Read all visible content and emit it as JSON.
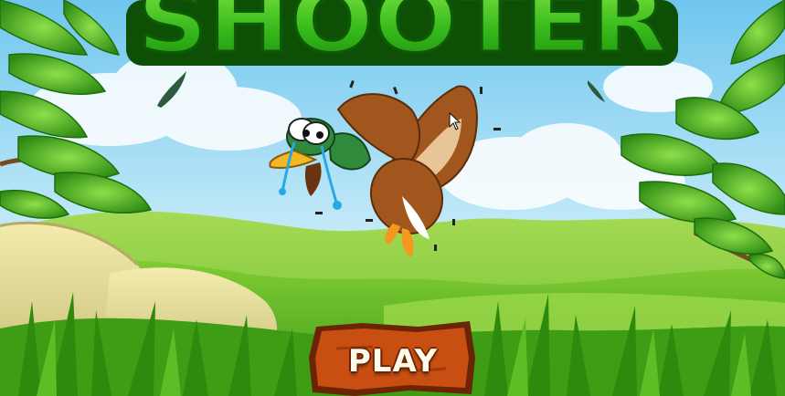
{
  "title": {
    "text": "SHOOTER"
  },
  "menu": {
    "play_label": "PLAY"
  },
  "colors": {
    "sky_top": "#7fcdf0",
    "sky_bottom": "#d8f1fb",
    "title_fill": "#3ec41c",
    "title_outline": "#0f5a06",
    "button_fill": "#c84e12",
    "button_border": "#6b2405",
    "grass": "#4fae1e"
  },
  "icons": {
    "cursor": "mouse-pointer-icon",
    "feather": "feather-icon"
  }
}
